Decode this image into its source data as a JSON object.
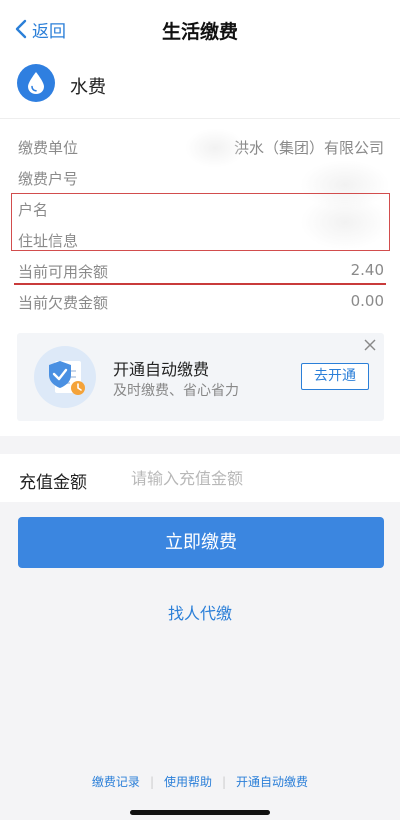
{
  "nav": {
    "back_label": "返回",
    "title": "生活缴费"
  },
  "service": {
    "icon": "water-drop-icon",
    "name": "水费"
  },
  "info": [
    {
      "label": "缴费单位",
      "value": "洪水（集团）有限公司"
    },
    {
      "label": "缴费户号",
      "value": ""
    },
    {
      "label": "户名",
      "value": ""
    },
    {
      "label": "住址信息",
      "value": ""
    },
    {
      "label": "当前可用余额",
      "value": "2.40"
    },
    {
      "label": "当前欠费金额",
      "value": "0.00"
    }
  ],
  "promo": {
    "title": "开通自动缴费",
    "subtitle": "及时缴费、省心省力",
    "button_label": "去开通"
  },
  "recharge": {
    "label": "充值金额",
    "placeholder": "请输入充值金额"
  },
  "pay_button_label": "立即缴费",
  "proxy_link_label": "找人代缴",
  "footer": {
    "records": "缴费记录",
    "help": "使用帮助",
    "auto": "开通自动缴费"
  },
  "colors": {
    "accent": "#3b86e0",
    "highlight": "#d24d4d"
  }
}
